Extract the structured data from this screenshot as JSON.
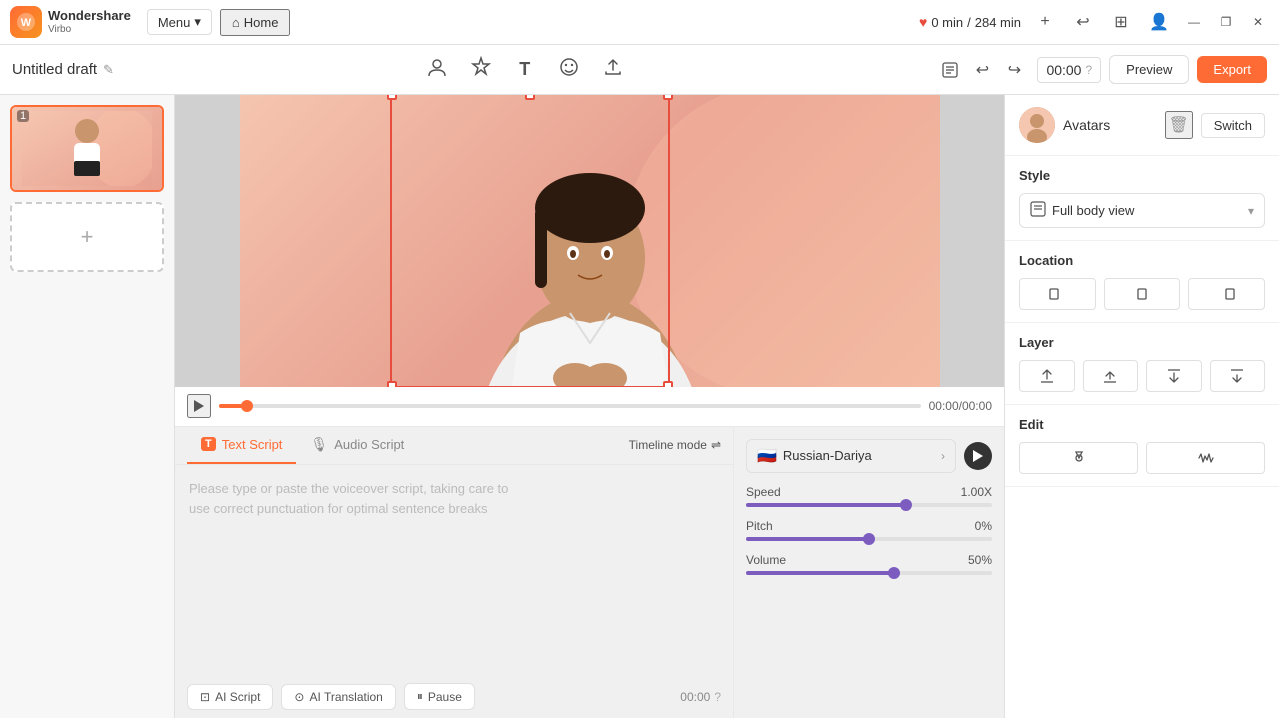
{
  "app": {
    "logo_text": "Wondershare",
    "logo_sub": "Virbo",
    "logo_initials": "W"
  },
  "topbar": {
    "menu_label": "Menu",
    "home_label": "Home",
    "time_used": "0 min",
    "time_total": "284 min",
    "add_label": "+",
    "minimize_label": "—",
    "maximize_label": "❐",
    "close_label": "✕"
  },
  "header": {
    "draft_title": "Untitled draft",
    "edit_icon": "✎",
    "time_display": "00:00",
    "preview_label": "Preview",
    "export_label": "Export"
  },
  "toolbar": {
    "avatar_icon": "☺",
    "style_icon": "✦",
    "text_icon": "T",
    "emoji_icon": "☻",
    "upload_icon": "↑"
  },
  "slides": [
    {
      "number": "1",
      "active": true
    }
  ],
  "add_slide": "+",
  "timeline": {
    "time_current": "00:00",
    "time_total": "00:00",
    "full_time": "00:00/00:00"
  },
  "script_tabs": [
    {
      "id": "text",
      "label": "Text Script",
      "active": true
    },
    {
      "id": "audio",
      "label": "Audio Script",
      "active": false
    }
  ],
  "timeline_mode_label": "Timeline mode",
  "script_placeholder_line1": "Please type or paste the voiceover script, taking care to",
  "script_placeholder_line2": "use correct punctuation for optimal sentence breaks",
  "script_actions": [
    {
      "id": "ai-script",
      "label": "AI Script",
      "icon": "⊡"
    },
    {
      "id": "ai-translation",
      "label": "AI Translation",
      "icon": "⊙"
    },
    {
      "id": "pause",
      "label": "Pause",
      "icon": "⏸"
    }
  ],
  "script_time": "00:00",
  "audio": {
    "voice_name": "Russian-Dariya",
    "flag": "🇷🇺",
    "speed_label": "Speed",
    "speed_value": "1.00X",
    "speed_percent": 65,
    "pitch_label": "Pitch",
    "pitch_value": "0%",
    "pitch_percent": 50,
    "volume_label": "Volume",
    "volume_value": "50%",
    "volume_percent": 60
  },
  "right_panel": {
    "avatars_label": "Avatars",
    "switch_label": "Switch",
    "style_label": "Style",
    "style_option": "Full body view",
    "location_label": "Location",
    "layer_label": "Layer",
    "edit_label": "Edit"
  }
}
